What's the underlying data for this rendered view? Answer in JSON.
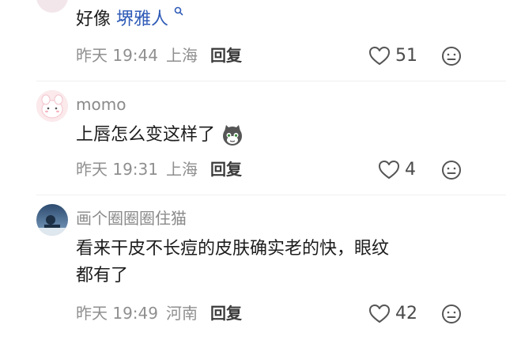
{
  "comments": [
    {
      "text_prefix": "好像 ",
      "link_text": "堺雅人",
      "time": "昨天 19:44",
      "location": "上海",
      "reply_label": "回复",
      "likes": "51"
    },
    {
      "username": "momo",
      "text": "上唇怎么变这样了",
      "time": "昨天 19:31",
      "location": "上海",
      "reply_label": "回复",
      "likes": "4"
    },
    {
      "username": "画个圈圈圈住猫",
      "text_line1": "看来干皮不长痘的皮肤确实老的快，眼纹",
      "text_line2": "都有了",
      "time": "昨天 19:49",
      "location": "河南",
      "reply_label": "回复",
      "likes": "42"
    }
  ]
}
